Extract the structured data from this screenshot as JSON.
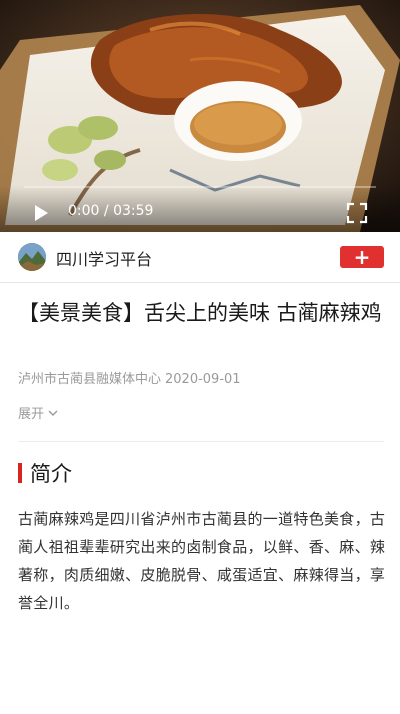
{
  "video": {
    "current_time": "0:00",
    "separator": " / ",
    "duration": "03:59",
    "progress": 0
  },
  "channel": {
    "name": "四川学习平台",
    "follow_label": "+"
  },
  "article": {
    "title": "【美景美食】舌尖上的美味 古蔺麻辣鸡",
    "source": "泸州市古蔺县融媒体中心",
    "date": "2020-09-01",
    "expand_label": "展开"
  },
  "section": {
    "heading": "简介",
    "body": "古蔺麻辣鸡是四川省泸州市古蔺县的一道特色美食，古蔺人祖祖辈辈研究出来的卤制食品，以鲜、香、麻、辣著称，肉质细嫩、皮脆脱骨、咸蛋适宜、麻辣得当，享誉全川。"
  },
  "colors": {
    "accent": "#e03030",
    "section_marker": "#d7261e"
  },
  "icons": {
    "play": "play-icon",
    "fullscreen": "fullscreen-icon",
    "expand": "chevron-down-icon",
    "add": "plus-icon"
  }
}
